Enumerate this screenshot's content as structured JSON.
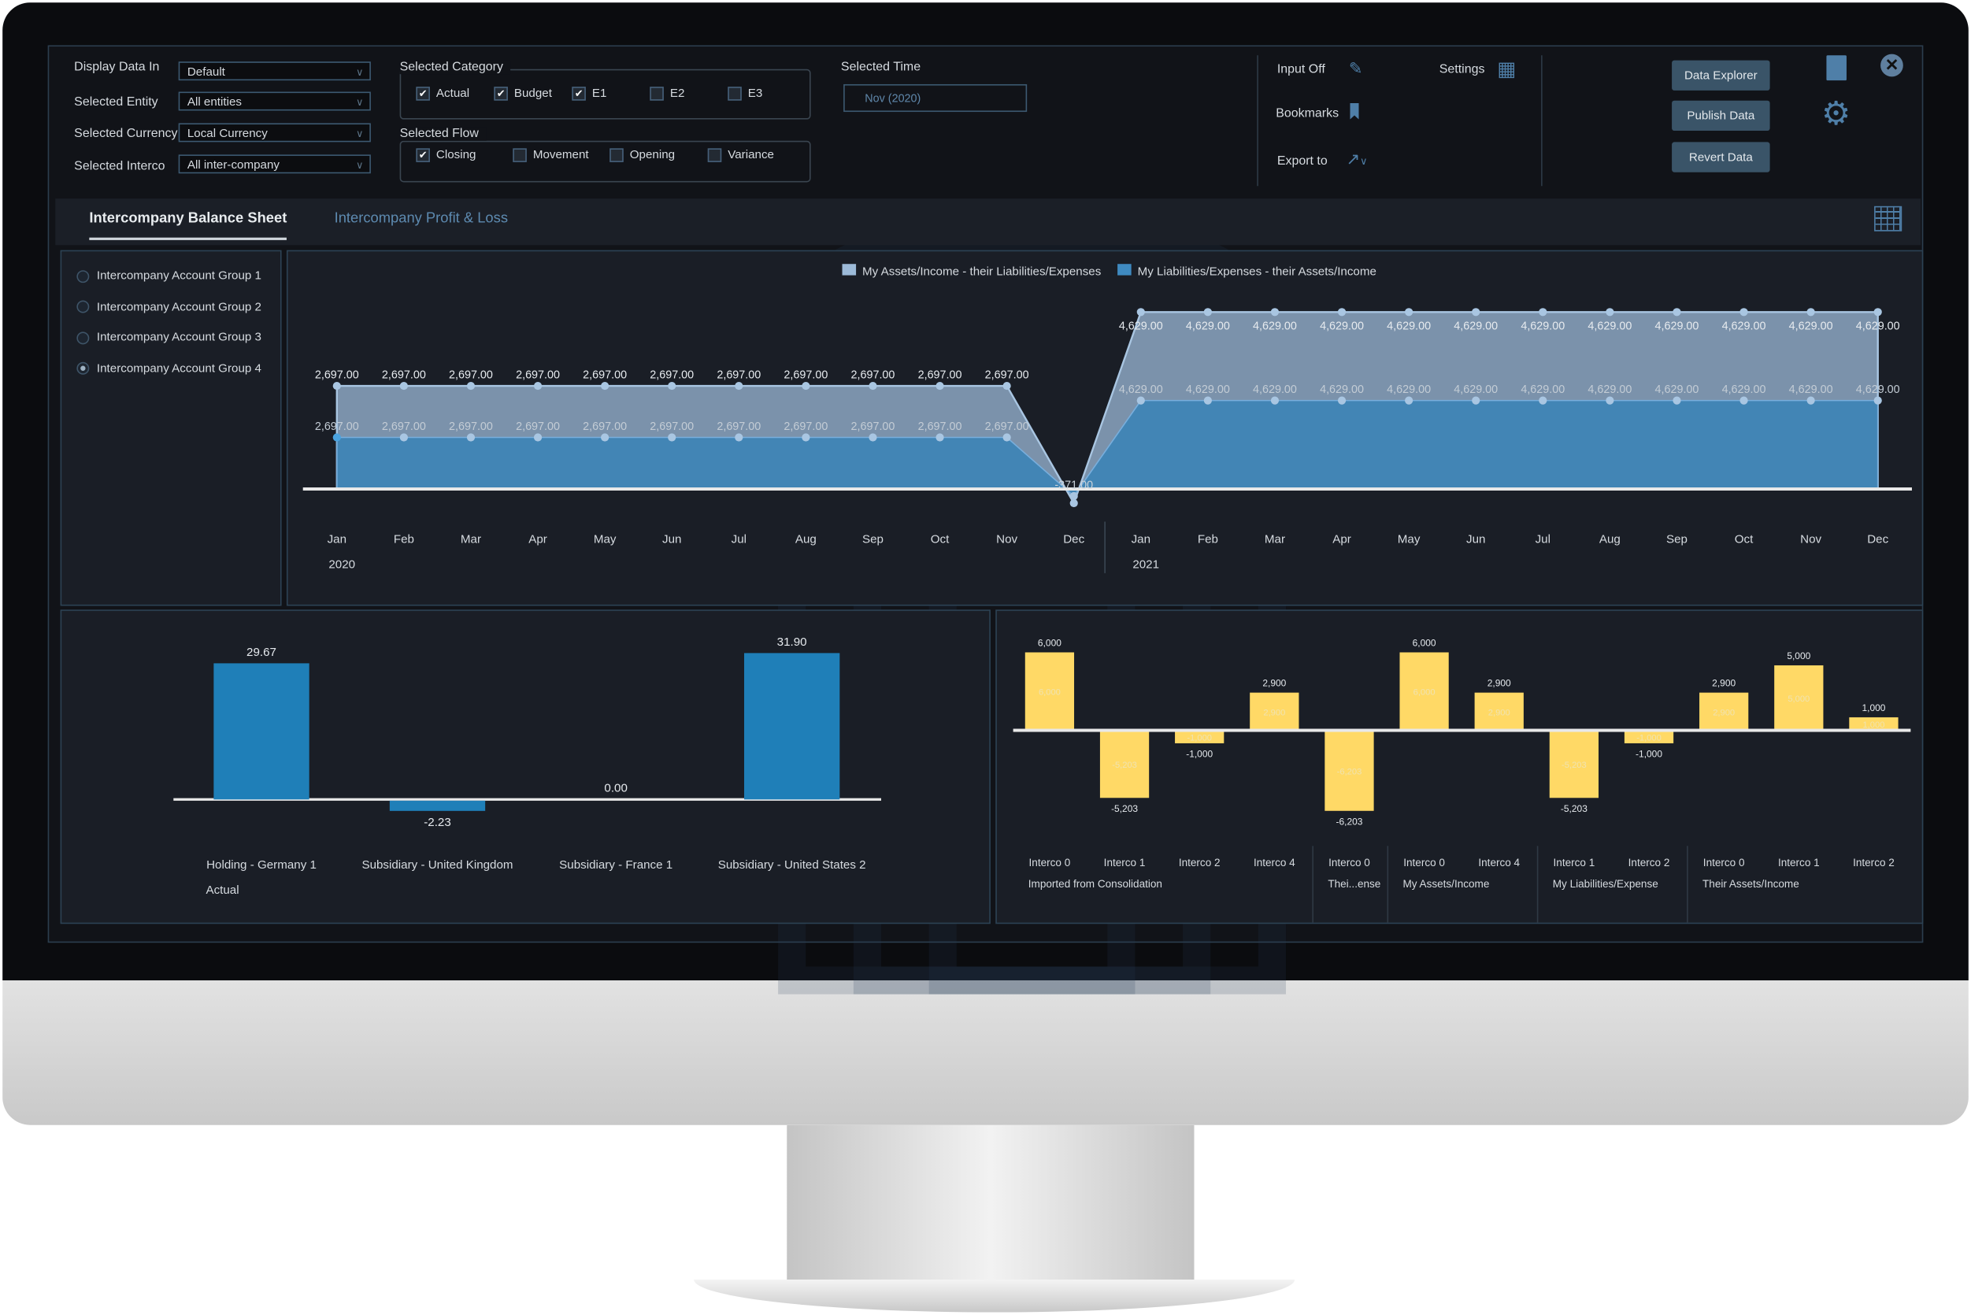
{
  "filters": {
    "display_data_in": {
      "label": "Display Data In",
      "value": "Default"
    },
    "selected_entity": {
      "label": "Selected Entity",
      "value": "All entities"
    },
    "selected_currency": {
      "label": "Selected Currency",
      "value": "Local Currency"
    },
    "selected_interco": {
      "label": "Selected Interco",
      "value": "All inter-company"
    }
  },
  "category": {
    "title": "Selected Category",
    "items": [
      {
        "label": "Actual",
        "checked": true
      },
      {
        "label": "Budget",
        "checked": true
      },
      {
        "label": "E1",
        "checked": true
      },
      {
        "label": "E2",
        "checked": false
      },
      {
        "label": "E3",
        "checked": false
      }
    ]
  },
  "flow": {
    "title": "Selected Flow",
    "items": [
      {
        "label": "Closing",
        "checked": true
      },
      {
        "label": "Movement",
        "checked": false
      },
      {
        "label": "Opening",
        "checked": false
      },
      {
        "label": "Variance",
        "checked": false
      }
    ]
  },
  "time": {
    "label": "Selected Time",
    "value": "Nov (2020)"
  },
  "tools": {
    "input": "Input Off",
    "settings": "Settings",
    "bookmarks": "Bookmarks",
    "export": "Export to"
  },
  "actions": {
    "data_explorer": "Data Explorer",
    "publish": "Publish Data",
    "revert": "Revert Data"
  },
  "tabs": [
    {
      "label": "Intercompany Balance Sheet",
      "active": true
    },
    {
      "label": "Intercompany Profit & Loss",
      "active": false
    }
  ],
  "account_groups": [
    {
      "label": "Intercompany Account Group 1",
      "selected": false
    },
    {
      "label": "Intercompany Account Group 2",
      "selected": false
    },
    {
      "label": "Intercompany Account Group 3",
      "selected": false
    },
    {
      "label": "Intercompany Account Group 4",
      "selected": true
    }
  ],
  "colors": {
    "accent": "#4a7aa0",
    "button": "#3a5468",
    "bar_blue": "#1f7fb8",
    "bar_yellow": "#ffd966",
    "area_light": "#9cbad8",
    "area_blue": "#3f8ac0"
  },
  "chart_data": [
    {
      "type": "area",
      "stacked": true,
      "categories": [
        "Jan",
        "Feb",
        "Mar",
        "Apr",
        "May",
        "Jun",
        "Jul",
        "Aug",
        "Sep",
        "Oct",
        "Nov",
        "Dec",
        "Jan",
        "Feb",
        "Mar",
        "Apr",
        "May",
        "Jun",
        "Jul",
        "Aug",
        "Sep",
        "Oct",
        "Nov",
        "Dec"
      ],
      "years": [
        {
          "label": "2020",
          "start": 0
        },
        {
          "label": "2021",
          "start": 12
        }
      ],
      "legend_position": "top",
      "series": [
        {
          "name": "My Assets/Income - their Liabilities/Expenses",
          "values": [
            2697,
            2697,
            2697,
            2697,
            2697,
            2697,
            2697,
            2697,
            2697,
            2697,
            2697,
            -371,
            4629,
            4629,
            4629,
            4629,
            4629,
            4629,
            4629,
            4629,
            4629,
            4629,
            4629,
            4629
          ]
        },
        {
          "name": "My Liabilities/Expenses - their Assets/Income",
          "values": [
            2697,
            2697,
            2697,
            2697,
            2697,
            2697,
            2697,
            2697,
            2697,
            2697,
            2697,
            -371,
            4629,
            4629,
            4629,
            4629,
            4629,
            4629,
            4629,
            4629,
            4629,
            4629,
            4629,
            4629
          ]
        }
      ],
      "data_labels": [
        "2,697.00",
        "2,697.00",
        "2,697.00",
        "2,697.00",
        "2,697.00",
        "2,697.00",
        "2,697.00",
        "2,697.00",
        "2,697.00",
        "2,697.00",
        "2,697.00",
        "-371.00",
        "4,629.00",
        "4,629.00",
        "4,629.00",
        "4,629.00",
        "4,629.00",
        "4,629.00",
        "4,629.00",
        "4,629.00",
        "4,629.00",
        "4,629.00",
        "4,629.00",
        "4,629.00"
      ]
    },
    {
      "type": "bar",
      "categories": [
        "Holding - Germany 1",
        "Subsidiary - United Kingdom",
        "Subsidiary - France 1",
        "Subsidiary - United States 2"
      ],
      "series": [
        {
          "name": "Actual",
          "values": [
            29.67,
            -2.23,
            0.0,
            31.9
          ]
        }
      ],
      "data_labels": [
        "29.67",
        "-2.23",
        "0.00",
        "31.90"
      ]
    },
    {
      "type": "bar",
      "categories": [
        "Interco 0",
        "Interco 1",
        "Interco 2",
        "Interco 4",
        "Interco 0",
        "Interco 0",
        "Interco 4",
        "Interco 1",
        "Interco 2",
        "Interco 0",
        "Interco 1",
        "Interco 2"
      ],
      "groups": [
        {
          "label": "Imported from Consolidation",
          "count": 4
        },
        {
          "label": "Thei...ense",
          "count": 1
        },
        {
          "label": "My Assets/Income",
          "count": 2
        },
        {
          "label": "My Liabilities/Expense",
          "count": 2
        },
        {
          "label": "Their Assets/Income",
          "count": 3
        }
      ],
      "values": [
        6000,
        -5203,
        -1000,
        2900,
        -6203,
        6000,
        2900,
        -5203,
        -1000,
        2900,
        5000,
        1000
      ],
      "data_labels": [
        "6,000",
        "-5,203",
        "-1,000",
        "2,900",
        "-6,203",
        "6,000",
        "2,900",
        "-5,203",
        "-1,000",
        "2,900",
        "5,000",
        "1,000"
      ]
    }
  ]
}
